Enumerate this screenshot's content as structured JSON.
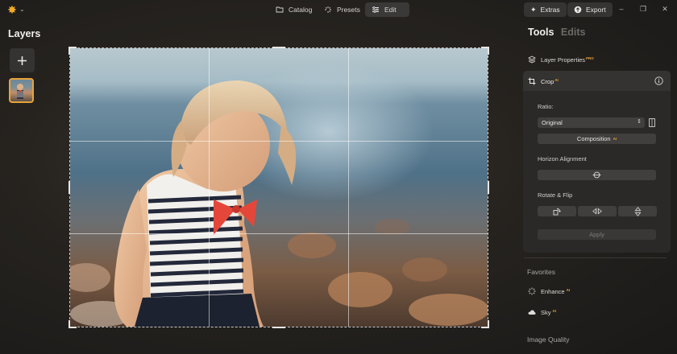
{
  "topbar": {
    "nav": [
      {
        "label": "Catalog",
        "icon": "folder-icon",
        "active": false
      },
      {
        "label": "Presets",
        "icon": "sparkle-icon",
        "active": false
      },
      {
        "label": "Edit",
        "icon": "sliders-icon",
        "active": true
      }
    ],
    "extras_label": "Extras",
    "export_label": "Export"
  },
  "left_panel": {
    "title": "Layers"
  },
  "right_panel": {
    "tabs": {
      "tools": "Tools",
      "edits": "Edits"
    },
    "layer_properties": {
      "label": "Layer Properties",
      "badge": "PRO"
    },
    "crop": {
      "label": "Crop",
      "badge": "AI",
      "ratio_label": "Ratio:",
      "ratio_value": "Original",
      "composition_label": "Composition",
      "composition_badge": "AI",
      "horizon_label": "Horizon Alignment",
      "rotate_label": "Rotate & Flip",
      "apply_label": "Apply"
    },
    "favorites": {
      "title": "Favorites",
      "items": [
        {
          "label": "Enhance",
          "badge": "AI",
          "icon": "sparkle-icon"
        },
        {
          "label": "Sky",
          "badge": "AI",
          "icon": "cloud-icon"
        }
      ]
    },
    "image_quality_title": "Image Quality"
  },
  "colors": {
    "accent": "#e8a33a",
    "panel": "#2a2928",
    "background": "#1c1b1a"
  }
}
